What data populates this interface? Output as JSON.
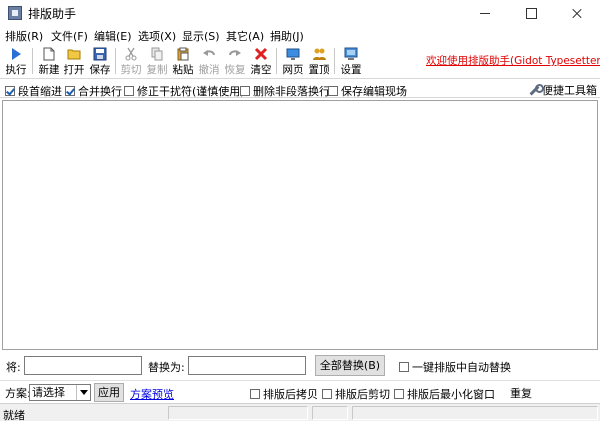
{
  "window": {
    "title": "排版助手"
  },
  "menu": [
    "排版(R)",
    "文件(F)",
    "编辑(E)",
    "选项(X)",
    "显示(S)",
    "其它(A)",
    "捐助(J)"
  ],
  "toolbar": {
    "execute": "执行",
    "new": "新建",
    "open": "打开",
    "save": "保存",
    "cut": "剪切",
    "copy": "复制",
    "paste": "粘贴",
    "undo": "撤消",
    "redo": "恢复",
    "clear": "清空",
    "webpage": "网页",
    "donate": "置顶",
    "settings": "设置",
    "welcome": "欢迎使用排版助手(Gidot Typesetter)"
  },
  "options": {
    "indent": {
      "label": "段首缩进",
      "checked": true
    },
    "merge_lines": {
      "label": "合并换行",
      "checked": true
    },
    "fix_interference": {
      "label": "修正干扰符(谨慎使用)",
      "checked": false
    },
    "delete_non_paragraph": {
      "label": "删除非段落换行",
      "checked": false
    },
    "save_edit_scene": {
      "label": "保存编辑现场",
      "checked": false
    },
    "toolbox": "便捷工具箱"
  },
  "editor": {
    "content": ""
  },
  "replace": {
    "find_label": "将:",
    "find_value": "",
    "replace_label": "替换为:",
    "replace_value": "",
    "replace_all": "全部替换(B)",
    "auto_replace": {
      "label": "一键排版中自动替换",
      "checked": false
    }
  },
  "scheme": {
    "label": "方案:",
    "selected": "请选择",
    "apply": "应用",
    "preview": "方案预览",
    "copy_after": {
      "label": "排版后拷贝",
      "checked": false
    },
    "cut_after": {
      "label": "排版后剪切",
      "checked": false
    },
    "minimize_after": {
      "label": "排版后最小化窗口",
      "checked": false
    },
    "repeat_label": "重复"
  },
  "status": {
    "text": "就绪"
  },
  "colors": {
    "welcome": "#e00000",
    "link": "#0000e0"
  }
}
